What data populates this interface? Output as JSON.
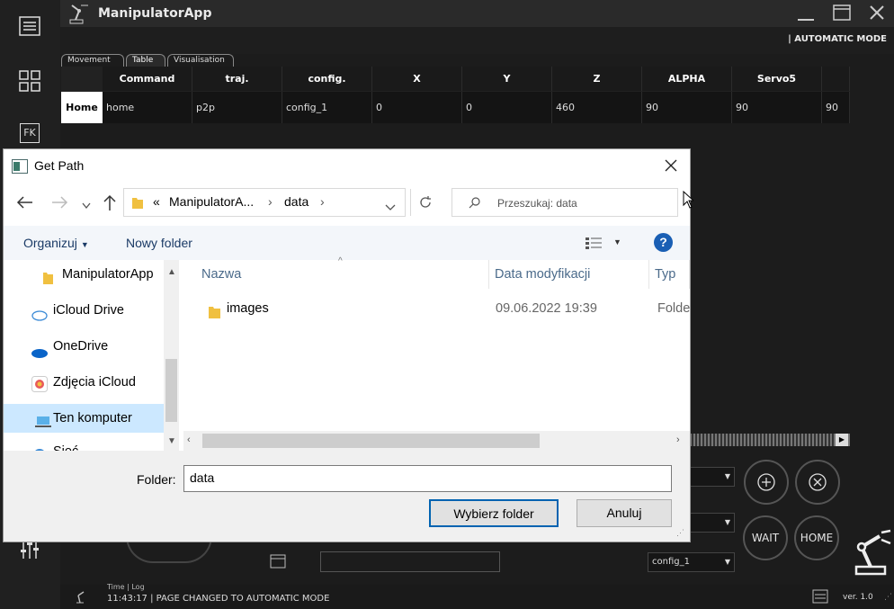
{
  "app": {
    "title": "ManipulatorApp",
    "mode": "| AUTOMATIC MODE",
    "sidebar_fk": "FK"
  },
  "tabs": [
    "Movement",
    "Table",
    "Visualisation"
  ],
  "table": {
    "headers": [
      "Command",
      "traj.",
      "config.",
      "X",
      "Y",
      "Z",
      "ALPHA",
      "Servo5"
    ],
    "row_label": "Home",
    "cells": [
      "home",
      "p2p",
      "config_1",
      "0",
      "0",
      "460",
      "90",
      "90",
      "90"
    ]
  },
  "controls": {
    "wait": "WAIT",
    "home": "HOME",
    "config_combo": "config_1"
  },
  "status": {
    "log_header": "Time | Log",
    "log": "11:43:17 | PAGE CHANGED TO AUTOMATIC MODE",
    "version": "ver. 1.0"
  },
  "dialog": {
    "title": "Get Path",
    "breadcrumb": [
      "«",
      "ManipulatorA...",
      "data"
    ],
    "search_placeholder": "Przeszukaj: data",
    "organize": "Organizuj",
    "new_folder": "Nowy folder",
    "tree": [
      "ManipulatorApp",
      "iCloud Drive",
      "OneDrive",
      "Zdjęcia iCloud",
      "Ten komputer",
      "Sieć"
    ],
    "columns": [
      "Nazwa",
      "Data modyfikacji",
      "Typ"
    ],
    "files": [
      {
        "name": "images",
        "date": "09.06.2022 19:39",
        "type": "Folde"
      }
    ],
    "folder_label": "Folder:",
    "folder_value": "data",
    "select_button": "Wybierz folder",
    "cancel_button": "Anuluj"
  },
  "colors": {
    "accent": "#0063b1",
    "dark_bg": "#1c1c1c"
  }
}
